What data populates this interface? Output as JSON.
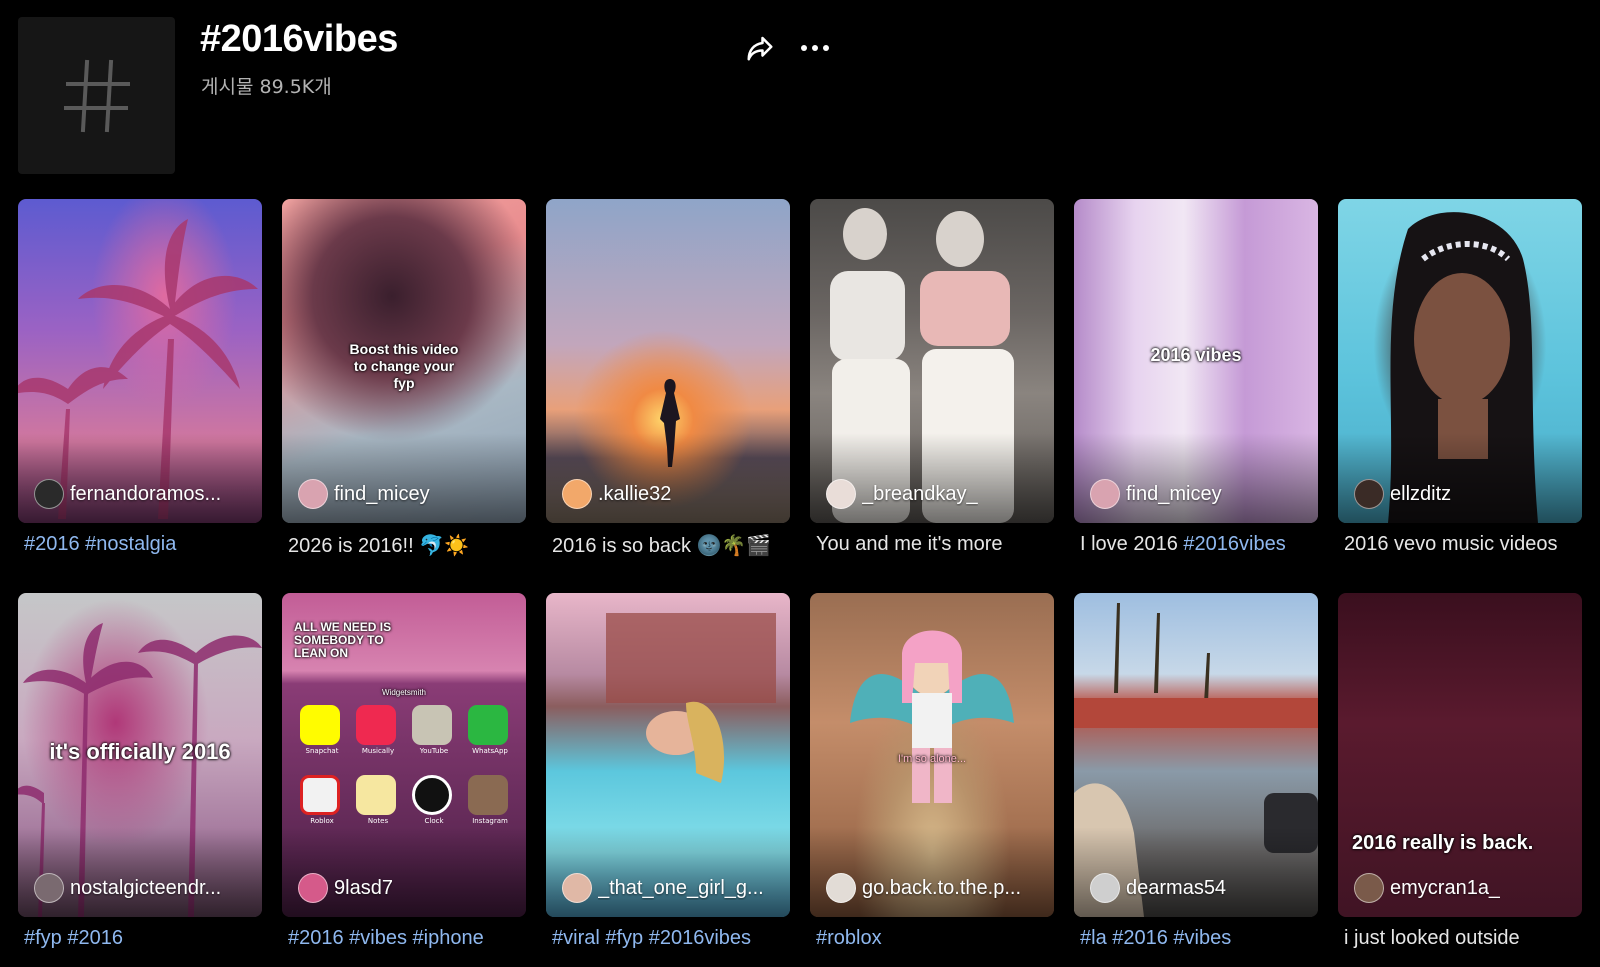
{
  "header": {
    "title": "#2016vibes",
    "post_count": "게시물 89.5K개"
  },
  "accent_colors": {
    "hashtag": "#8fb8ef",
    "background": "#000000"
  },
  "icons": {
    "share": "share-arrow-icon",
    "more": "more-dots-icon",
    "hashtag": "hashtag-icon"
  },
  "videos": [
    {
      "author": "fernandoramos...",
      "overlay": "",
      "caption_tags": "#2016 #nostalgia",
      "caption_text": ""
    },
    {
      "author": "find_micey",
      "overlay": "Boost this video to change your fyp",
      "caption_tags": "",
      "caption_text": "2026 is 2016!! 🐬☀️"
    },
    {
      "author": ".kallie32",
      "overlay": "",
      "caption_tags": "",
      "caption_text": "2016 is so back 🌚🌴🎬"
    },
    {
      "author": "_breandkay_",
      "overlay": "",
      "caption_tags": "",
      "caption_text": "You and me it's more"
    },
    {
      "author": "find_micey",
      "overlay": "2016 vibes",
      "caption_text": "I love 2016 ",
      "caption_tags": "#2016vibes"
    },
    {
      "author": "ellzditz",
      "overlay": "",
      "caption_tags": "",
      "caption_text": "2016 vevo music videos"
    },
    {
      "author": "nostalgicteendr...",
      "overlay": "it's officially 2016",
      "caption_tags": "#fyp #2016",
      "caption_text": ""
    },
    {
      "author": "9lasd7",
      "overlay": "ALL WE NEED IS SOMEBODY TO LEAN ON",
      "caption_tags": "#2016 #vibes #iphone",
      "caption_text": "",
      "apps": [
        "Snapchat",
        "Musically",
        "YouTube",
        "WhatsApp",
        "Roblox",
        "Notes",
        "Clock",
        "Instagram"
      ],
      "widget": "Widgetsmith"
    },
    {
      "author": "_that_one_girl_g...",
      "overlay": "",
      "caption_tags": "#viral #fyp #2016vibes",
      "caption_text": ""
    },
    {
      "author": "go.back.to.the.p...",
      "overlay": "I'm so alone...",
      "caption_tags": "#roblox",
      "caption_text": ""
    },
    {
      "author": "dearmas54",
      "overlay": "",
      "caption_tags": "#la #2016 #vibes",
      "caption_text": ""
    },
    {
      "author": "emycran1a_",
      "overlay": "2016 really is back.",
      "caption_tags": "",
      "caption_text": "i just looked outside"
    }
  ]
}
